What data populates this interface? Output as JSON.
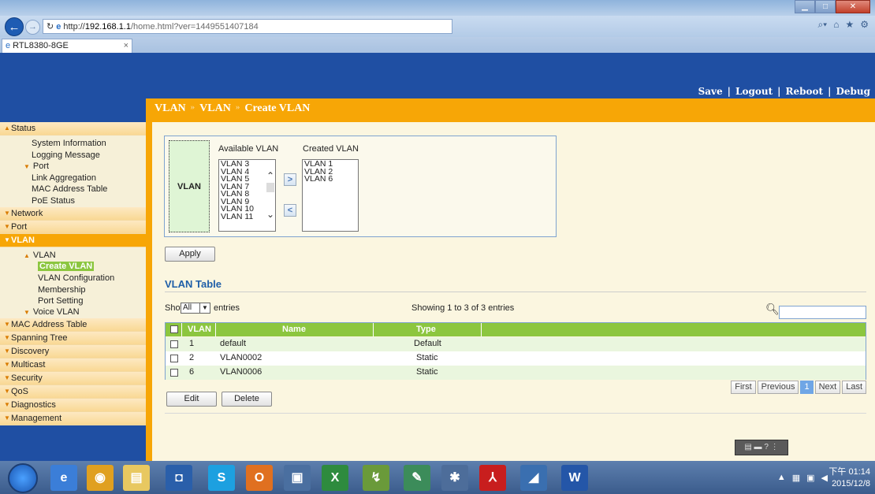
{
  "browser": {
    "url_scheme": "http://",
    "url_host": "192.168.1.1",
    "url_path": "/home.html?ver=1449551407184",
    "tab_title": "RTL8380-8GE",
    "tab_close": "×"
  },
  "toplinks": [
    "Save",
    "|",
    "Logout",
    "|",
    "Reboot",
    "|",
    "Debug"
  ],
  "breadcrumb": {
    "part1": "VLAN",
    "sep1": "»",
    "part2": "VLAN",
    "sep2": "»",
    "part3": "Create VLAN"
  },
  "sidebar": {
    "status": "Status",
    "system_information": "System Information",
    "logging_message": "Logging Message",
    "port_sub": "Port",
    "link_aggregation": "Link Aggregation",
    "mac_address_table_sub": "MAC Address Table",
    "poe_status": "PoE Status",
    "network": "Network",
    "port": "Port",
    "vlan": "VLAN",
    "vlan_sub": "VLAN",
    "create_vlan": "Create VLAN",
    "vlan_configuration": "VLAN Configuration",
    "membership": "Membership",
    "port_setting": "Port Setting",
    "voice_vlan": "Voice VLAN",
    "mac_address_table": "MAC Address Table",
    "spanning_tree": "Spanning Tree",
    "discovery": "Discovery",
    "multicast": "Multicast",
    "security": "Security",
    "qos": "QoS",
    "diagnostics": "Diagnostics",
    "management": "Management"
  },
  "vlan_form": {
    "label": "VLAN",
    "available_header": "Available VLAN",
    "created_header": "Created VLAN",
    "available": [
      "VLAN 3",
      "VLAN 4",
      "VLAN 5",
      "VLAN 7",
      "VLAN 8",
      "VLAN 9",
      "VLAN 10",
      "VLAN 11"
    ],
    "created": [
      "VLAN 1",
      "VLAN 2",
      "VLAN 6"
    ],
    "add_glyph": ">",
    "remove_glyph": "<",
    "apply_label": "Apply"
  },
  "vlan_table": {
    "title": "VLAN Table",
    "showing_prefix": "Showing",
    "showing_select": "All",
    "entries_suffix": "entries",
    "count_text": "Showing 1 to 3 of 3 entries",
    "col_vlan": "VLAN",
    "col_name": "Name",
    "col_type": "Type",
    "rows": [
      {
        "vlan": "1",
        "name": "default",
        "type": "Default"
      },
      {
        "vlan": "2",
        "name": "VLAN0002",
        "type": "Static"
      },
      {
        "vlan": "6",
        "name": "VLAN0006",
        "type": "Static"
      }
    ],
    "edit_label": "Edit",
    "delete_label": "Delete",
    "pager": {
      "first": "First",
      "previous": "Previous",
      "page": "1",
      "next": "Next",
      "last": "Last"
    }
  },
  "taskbar": {
    "time": "下午 01:14",
    "date": "2015/12/8"
  },
  "colors": {
    "orange": "#f7a606",
    "header_blue": "#1f4fa3",
    "table_green": "#8cc63f",
    "title_blue": "#1f5fa8"
  }
}
